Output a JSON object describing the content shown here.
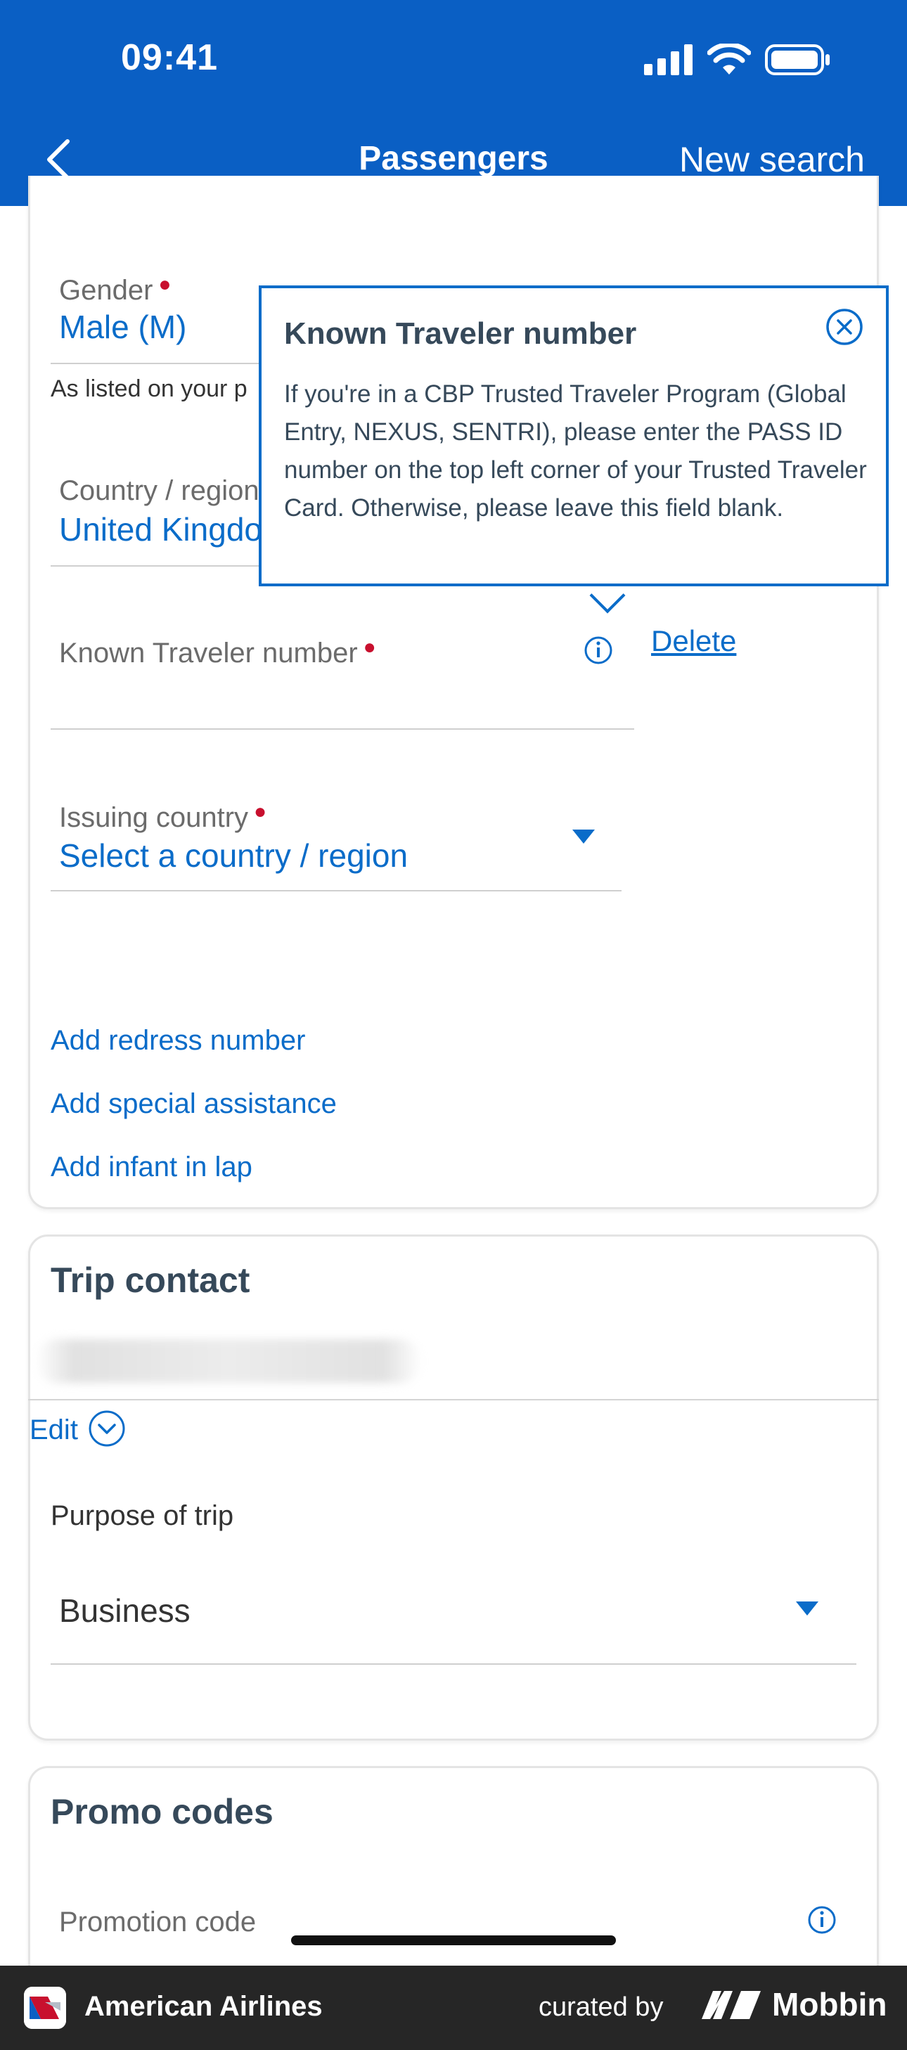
{
  "status_bar": {
    "time": "09:41"
  },
  "nav": {
    "title": "Passengers",
    "right_action": "New search"
  },
  "passenger": {
    "gender_label": "Gender",
    "gender_value": "Male (M)",
    "gender_hint": "As listed on your p",
    "country_label": "Country / region",
    "country_value": "United Kingdo",
    "ktn_label": "Known Traveler number",
    "delete_label": "Delete",
    "issuing_label": "Issuing country",
    "issuing_value": "Select a country / region",
    "links": [
      "Add redress number",
      "Add special assistance",
      "Add infant in lap"
    ]
  },
  "tooltip": {
    "title": "Known Traveler number",
    "body": "If you're in a CBP Trusted Traveler Program (Global Entry, NEXUS, SENTRI), please enter the PASS ID number on the top left corner of your Trusted Traveler Card. Otherwise, please leave this field blank."
  },
  "trip_contact": {
    "title": "Trip contact",
    "edit_label": "Edit",
    "purpose_label": "Purpose of trip",
    "purpose_value": "Business"
  },
  "promo": {
    "title": "Promo codes",
    "promotion_label": "Promotion code"
  },
  "footer": {
    "app_name": "American Airlines",
    "curated_by": "curated by",
    "brand": "Mobbin"
  },
  "colors": {
    "header_blue": "#0a5fc4",
    "link_blue": "#0a6cc9",
    "required_red": "#c8102e",
    "footer_bg": "#262626"
  }
}
